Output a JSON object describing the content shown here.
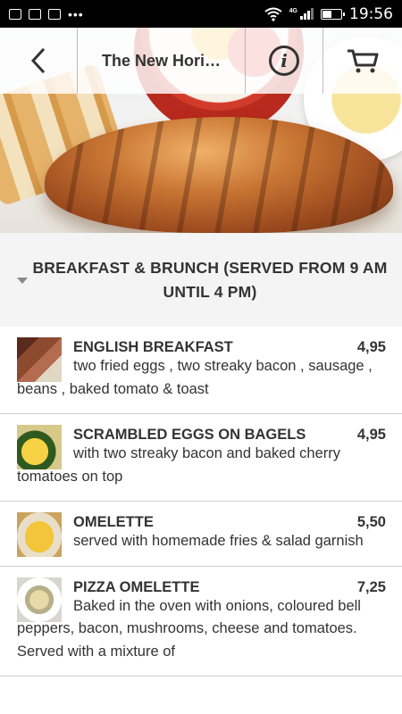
{
  "status_bar": {
    "time": "19:56",
    "network": "4G",
    "battery_level": 0.55,
    "left_icons": [
      "image-notification-icon",
      "app-notification-icon",
      "app-notification-icon",
      "more-dots-icon"
    ],
    "right_icons": [
      "wifi-icon",
      "signal-icon",
      "battery-icon"
    ]
  },
  "header": {
    "title": "The New Hori…",
    "back_icon": "chevron-left-icon",
    "info_icon": "info-icon",
    "cart_icon": "cart-icon"
  },
  "section": {
    "title": "BREAKFAST & BRUNCH (SERVED FROM 9 AM UNTIL 4 PM)",
    "expand_icon": "triangle-down-icon"
  },
  "menu": {
    "items": [
      {
        "name": "ENGLISH BREAKFAST",
        "price": "4,95",
        "description": "two fried eggs , two streaky bacon , sausage , beans , baked tomato & toast"
      },
      {
        "name": "SCRAMBLED EGGS ON BAGELS",
        "price": "4,95",
        "description": "with two streaky bacon and baked cherry tomatoes on top"
      },
      {
        "name": "OMELETTE",
        "price": "5,50",
        "description": "served with homemade fries & salad garnish"
      },
      {
        "name": "PIZZA OMELETTE",
        "price": "7,25",
        "description": "Baked in the oven with onions, coloured bell peppers, bacon, mushrooms, cheese and tomatoes. Served with a mixture of"
      }
    ]
  },
  "colors": {
    "text": "#333333",
    "section_bg": "#f4f4f4",
    "divider": "#cfcfcf",
    "status_bar": "#000000"
  }
}
